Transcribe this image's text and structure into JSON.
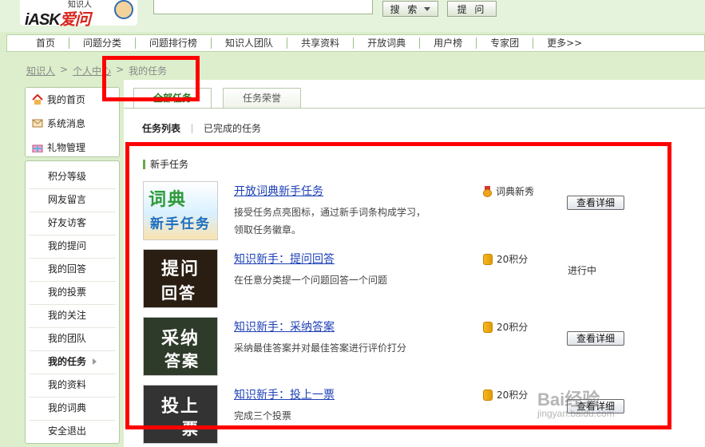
{
  "header": {
    "logo_text": "iASK",
    "logo_text_red": "爱问",
    "logo_tagline": "知识人",
    "search_label": "搜 索",
    "ask_label": "提 问"
  },
  "nav": [
    "首页",
    "问题分类",
    "问题排行榜",
    "知识人团队",
    "共享资料",
    "开放词典",
    "用户榜",
    "专家团",
    "更多>>"
  ],
  "breadcrumb": {
    "item1": "知识人",
    "sep1": ">",
    "item2": "个人中心",
    "sep2": ">",
    "item3": "我的任务"
  },
  "sidebar_top": [
    {
      "label": "我的首页",
      "icon": "home-icon"
    },
    {
      "label": "系统消息",
      "icon": "mail-icon"
    },
    {
      "label": "礼物管理",
      "icon": "gift-icon"
    }
  ],
  "sidebar": [
    {
      "label": "积分等级"
    },
    {
      "label": "网友留言"
    },
    {
      "label": "好友访客"
    },
    {
      "label": "我的提问"
    },
    {
      "label": "我的回答"
    },
    {
      "label": "我的投票"
    },
    {
      "label": "我的关注"
    },
    {
      "label": "我的团队"
    },
    {
      "label": "我的任务"
    },
    {
      "label": "我的资料"
    },
    {
      "label": "我的词典"
    },
    {
      "label": "安全退出"
    }
  ],
  "tabs": [
    "全部任务",
    "任务荣誉"
  ],
  "subtabs": [
    "任务列表",
    "已完成的任务"
  ],
  "section_title": "新手任务",
  "tasks": [
    {
      "thumb_top": "词典",
      "thumb_bottom": "新手任务",
      "title": "开放词典新手任务",
      "desc": "接受任务点亮图标，通过新手词条构成学习，领取任务徽章。",
      "reward": "词典新秀",
      "reward_icon": "medal-icon",
      "action": "查看详细"
    },
    {
      "thumb_top": "提问",
      "thumb_bottom": "回答",
      "title": "知识新手：提问回答",
      "desc": "在任意分类提一个问题回答一个问题",
      "reward": "20积分",
      "reward_icon": "coin-icon",
      "status": "进行中"
    },
    {
      "thumb_top": "采纳",
      "thumb_bottom": "答案",
      "title": "知识新手：采纳答案",
      "desc": "采纳最佳答案并对最佳答案进行评价打分",
      "reward": "20积分",
      "reward_icon": "coin-icon",
      "action": "查看详细"
    },
    {
      "thumb_top": "投上",
      "thumb_bottom": "一票",
      "title": "知识新手：投上一票",
      "desc": "完成三个投票",
      "reward": "20积分",
      "reward_icon": "coin-icon",
      "action": "查看详细"
    }
  ],
  "watermark": {
    "text": "Bai经验",
    "url": "jingyan.baidu.com"
  }
}
